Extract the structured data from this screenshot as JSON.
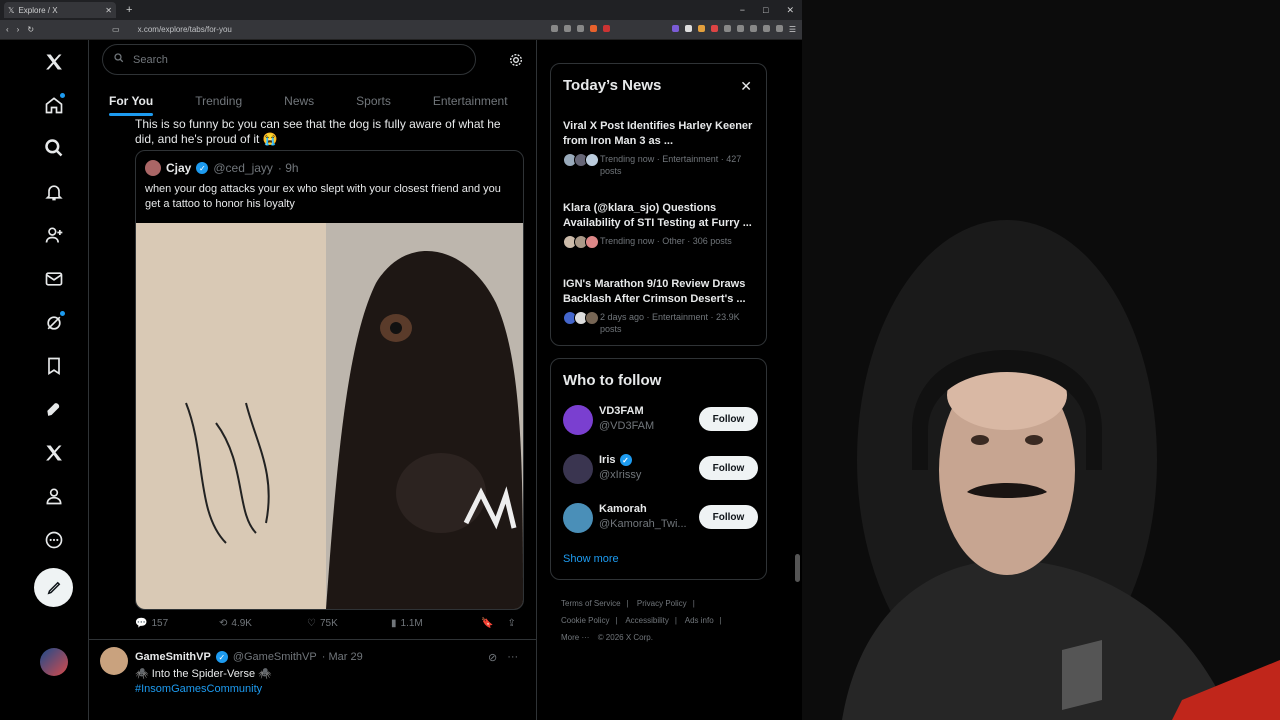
{
  "browser": {
    "tab_title": "Explore / X",
    "tab_close": "✕",
    "new_tab": "+",
    "url": "x.com/explore/tabs/for-you",
    "window_controls": [
      "−",
      "□",
      "✕"
    ]
  },
  "nav": {
    "items": [
      "x-logo",
      "home",
      "explore",
      "notifications",
      "communities",
      "messages",
      "grok",
      "bookmarks",
      "jobs",
      "premium",
      "profile",
      "more"
    ]
  },
  "search": {
    "placeholder": "Search"
  },
  "tabs": [
    "For You",
    "Trending",
    "News",
    "Sports",
    "Entertainment"
  ],
  "post": {
    "text_partial": "This is so funny bc you can see that the dog is fully aware of what he did, and he's proud of it 😭",
    "quote": {
      "name": "Cjay",
      "handle": "@ced_jayy",
      "time": "· 9h",
      "text": "when your dog attacks your ex who slept with your closest friend and you get a tattoo to honor his loyalty"
    },
    "actions": {
      "replies": "157",
      "reposts": "4.9K",
      "likes": "75K",
      "views": "1.1M"
    }
  },
  "post2": {
    "name": "GameSmithVP",
    "handle": "@GameSmithVP",
    "time": "· Mar 29",
    "text": "🕷️ Into the Spider-Verse 🕷️",
    "tag": "#InsomGamesCommunity"
  },
  "news": {
    "title": "Today’s News",
    "close": "✕",
    "items": [
      {
        "title": "Viral X Post Identifies Harley Keener from Iron Man 3 as ...",
        "meta": "Trending now · Entertainment · 427 posts"
      },
      {
        "title": "Klara (@klara_sjo) Questions Availability of STI Testing at Furry ...",
        "meta": "Trending now · Other · 306 posts"
      },
      {
        "title": "IGN's Marathon 9/10 Review Draws Backlash After Crimson Desert's ...",
        "meta": "2 days ago · Entertainment · 23.9K posts"
      }
    ]
  },
  "follow": {
    "title": "Who to follow",
    "button_label": "Follow",
    "users": [
      {
        "name": "VD3FAM",
        "handle": "@VD3FAM",
        "verified": false
      },
      {
        "name": "Iris",
        "handle": "@xIrissy",
        "verified": true
      },
      {
        "name": "Kamorah",
        "handle": "@Kamorah_Twi...",
        "verified": false
      }
    ],
    "show_more": "Show more"
  },
  "footer": {
    "links": [
      "Terms of Service",
      "|",
      "Privacy Policy",
      "|",
      "Cookie Policy",
      "|",
      "Accessibility",
      "|",
      "Ads info",
      "|",
      "More ···",
      "© 2026 X Corp."
    ]
  },
  "colors": {
    "accent": "#1d9bf0",
    "background": "#000000",
    "border": "#2f3336",
    "muted": "#71767b"
  }
}
